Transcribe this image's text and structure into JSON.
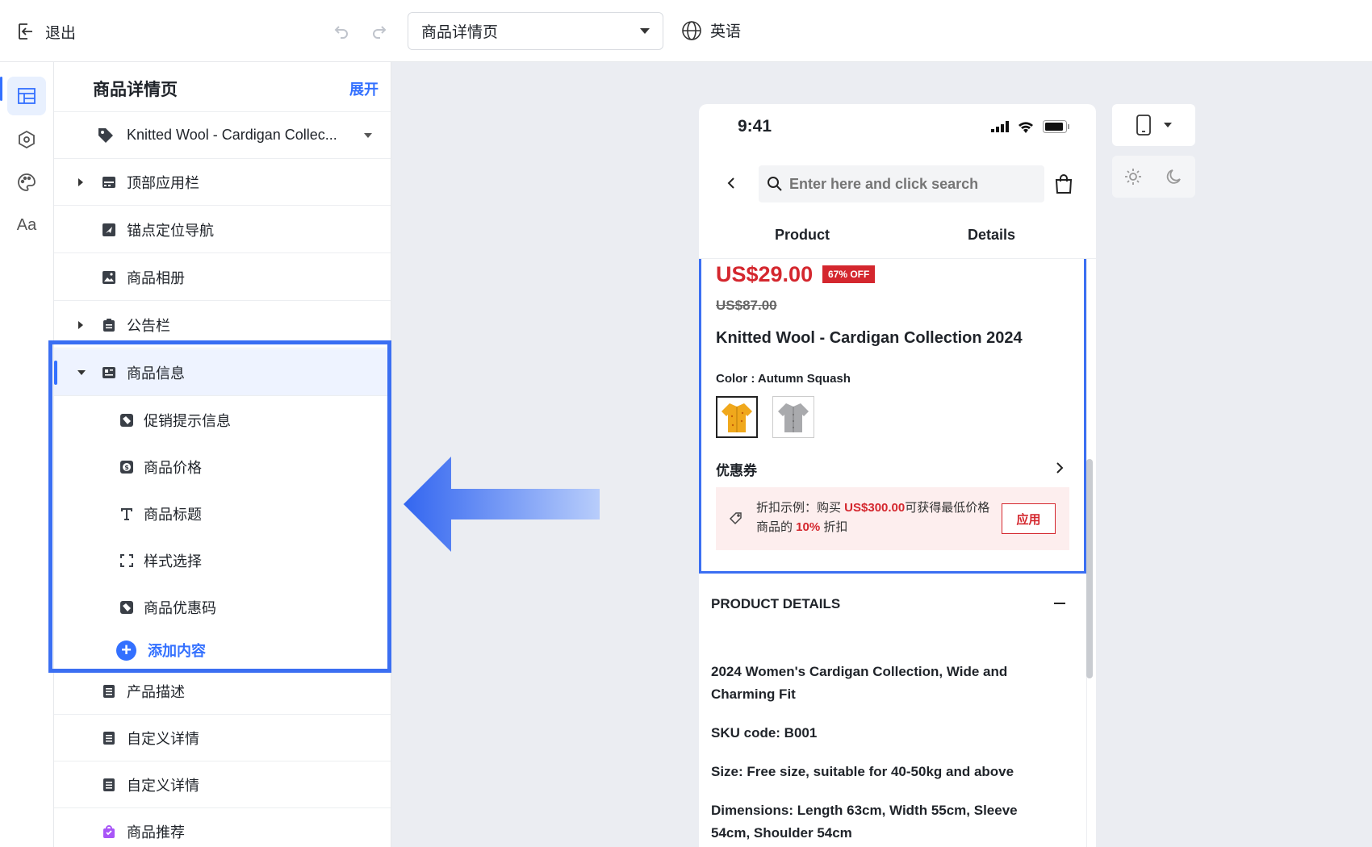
{
  "topbar": {
    "exit_label": "退出",
    "page_select_value": "商品详情页",
    "lang_label": "英语"
  },
  "rail": {
    "text_tab": "Aa"
  },
  "panel": {
    "title": "商品详情页",
    "expand": "展开",
    "product_select": "Knitted Wool - Cardigan Collec...",
    "rows": [
      {
        "label": "顶部应用栏"
      },
      {
        "label": "锚点定位导航"
      },
      {
        "label": "商品相册"
      },
      {
        "label": "公告栏"
      },
      {
        "label": "商品信息"
      }
    ],
    "subrows": [
      {
        "label": "促销提示信息"
      },
      {
        "label": "商品价格"
      },
      {
        "label": "商品标题"
      },
      {
        "label": "样式选择"
      },
      {
        "label": "商品优惠码"
      }
    ],
    "add_content": "添加内容",
    "bottom_rows": [
      {
        "label": "产品描述"
      },
      {
        "label": "自定义详情"
      },
      {
        "label": "自定义详情"
      },
      {
        "label": "商品推荐"
      }
    ]
  },
  "phone": {
    "time": "9:41",
    "search_placeholder": "Enter here and click search",
    "tabs": [
      "Product",
      "Details"
    ],
    "price": "US$29.00",
    "off_badge": "67% OFF",
    "old_price": "US$87.00",
    "title": "Knitted Wool - Cardigan Collection 2024",
    "color_label": "Color : Autumn Squash",
    "coupon_heading": "优惠券",
    "coupon_text_prefix": "折扣示例：购买 ",
    "coupon_amount": "US$300.00",
    "coupon_text_mid": "可获得最低价格商品的 ",
    "coupon_percent": "10%",
    "coupon_text_suffix": " 折扣",
    "apply": "应用",
    "details_heading": "PRODUCT DETAILS",
    "details": [
      "2024 Women's Cardigan Collection, Wide and Charming Fit",
      "SKU code: B001",
      "Size: Free size, suitable for 40-50kg and above",
      "Dimensions: Length 63cm, Width 55cm, Sleeve 54cm, Shoulder 54cm"
    ]
  },
  "colors": {
    "accent": "#3370ff",
    "highlight": "#3b6ff2",
    "price_red": "#d4272e"
  }
}
